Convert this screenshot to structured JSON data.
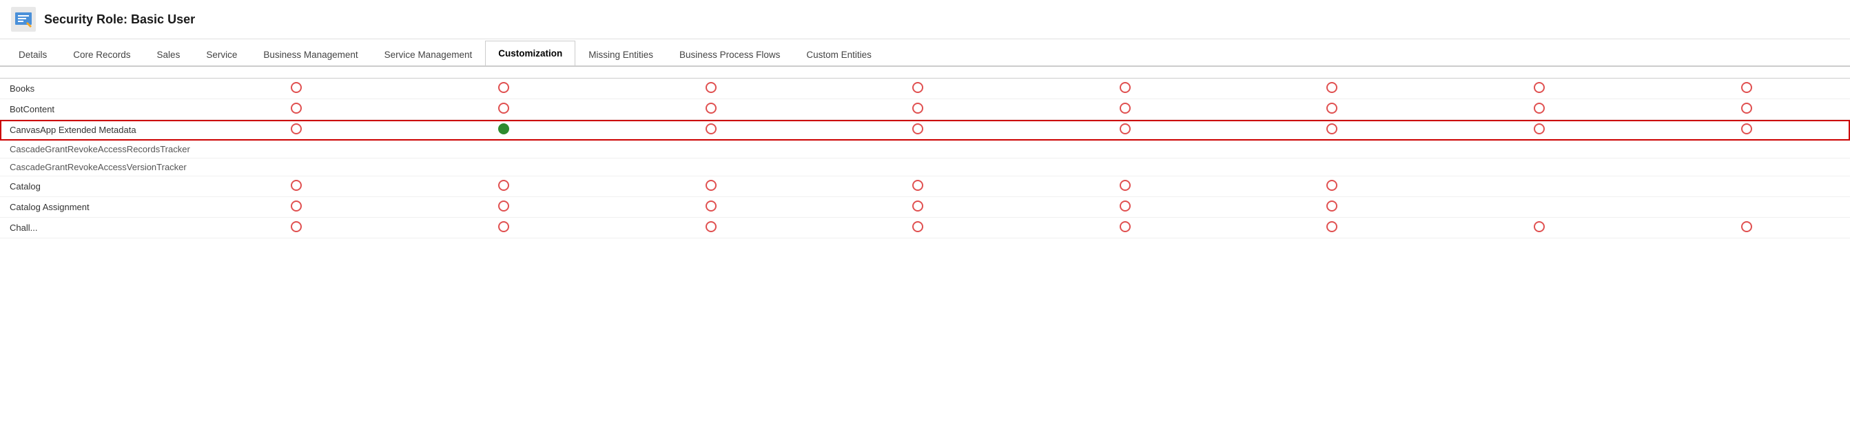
{
  "header": {
    "title": "Security Role: Basic User",
    "icon_label": "security-role-icon"
  },
  "tabs": [
    {
      "label": "Details",
      "active": false
    },
    {
      "label": "Core Records",
      "active": false
    },
    {
      "label": "Sales",
      "active": false
    },
    {
      "label": "Service",
      "active": false
    },
    {
      "label": "Business Management",
      "active": false
    },
    {
      "label": "Service Management",
      "active": false
    },
    {
      "label": "Customization",
      "active": true
    },
    {
      "label": "Missing Entities",
      "active": false
    },
    {
      "label": "Business Process Flows",
      "active": false
    },
    {
      "label": "Custom Entities",
      "active": false
    }
  ],
  "table": {
    "columns": [
      {
        "label": "",
        "key": "entity"
      },
      {
        "label": "col1"
      },
      {
        "label": "col2"
      },
      {
        "label": "col3"
      },
      {
        "label": "col4"
      },
      {
        "label": "col5"
      },
      {
        "label": "col6"
      },
      {
        "label": "col7"
      },
      {
        "label": "col8"
      }
    ],
    "rows": [
      {
        "name": "Books",
        "highlighted": false,
        "no_circles": false,
        "circles": [
          "empty",
          "empty",
          "empty",
          "empty",
          "empty",
          "empty",
          "empty",
          "empty"
        ]
      },
      {
        "name": "BotContent",
        "highlighted": false,
        "no_circles": false,
        "circles": [
          "empty",
          "empty",
          "empty",
          "empty",
          "empty",
          "empty",
          "empty",
          "empty"
        ]
      },
      {
        "name": "CanvasApp Extended Metadata",
        "highlighted": true,
        "no_circles": false,
        "circles": [
          "empty",
          "filled",
          "empty",
          "empty",
          "empty",
          "empty",
          "empty",
          "empty"
        ]
      },
      {
        "name": "CascadeGrantRevokeAccessRecordsTracker",
        "highlighted": false,
        "no_circles": true,
        "circles": []
      },
      {
        "name": "CascadeGrantRevokeAccessVersionTracker",
        "highlighted": false,
        "no_circles": true,
        "circles": []
      },
      {
        "name": "Catalog",
        "highlighted": false,
        "no_circles": false,
        "circles": [
          "empty",
          "empty",
          "empty",
          "empty",
          "empty",
          "empty",
          "",
          ""
        ]
      },
      {
        "name": "Catalog Assignment",
        "highlighted": false,
        "no_circles": false,
        "circles": [
          "empty",
          "empty",
          "empty",
          "empty",
          "empty",
          "empty",
          "",
          ""
        ]
      },
      {
        "name": "Chall...",
        "highlighted": false,
        "no_circles": false,
        "circles": [
          "empty",
          "empty",
          "empty",
          "empty",
          "empty",
          "empty",
          "empty",
          "empty"
        ]
      }
    ]
  }
}
